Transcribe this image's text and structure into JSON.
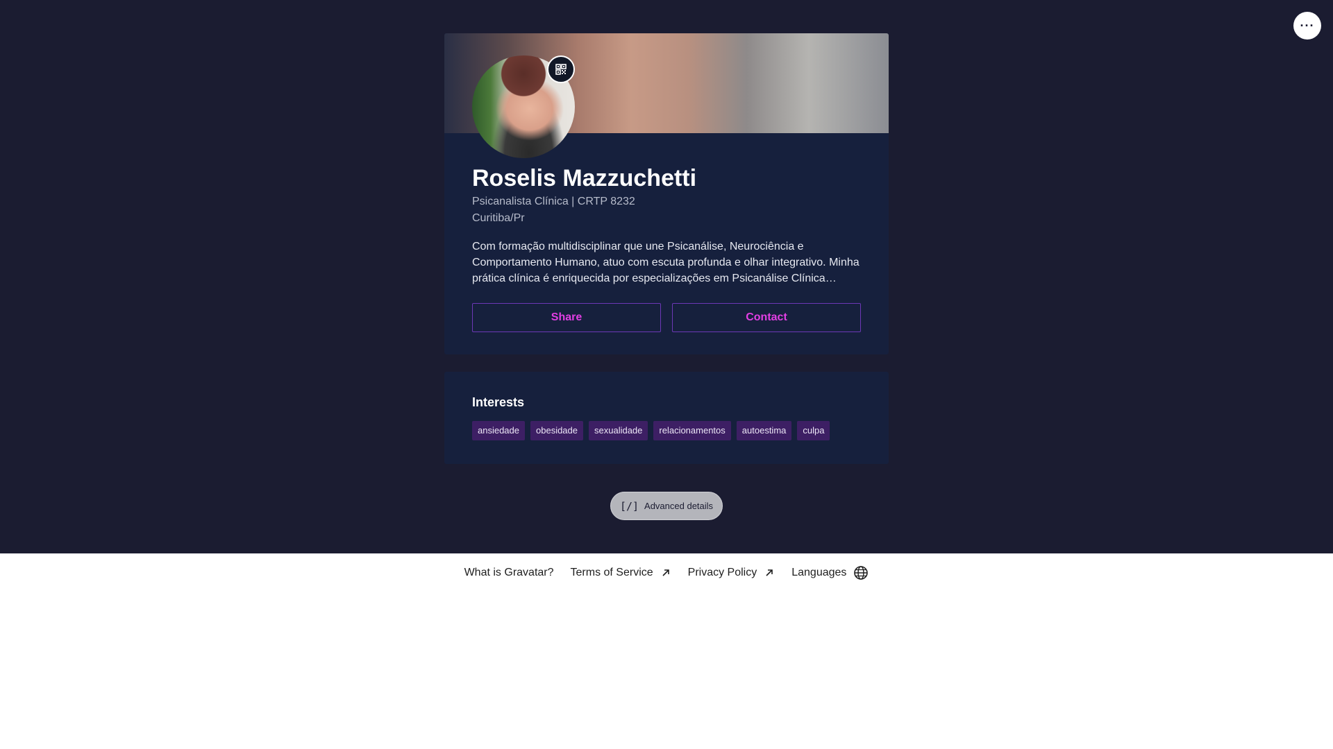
{
  "topbar": {
    "more_icon": "more-horizontal-icon",
    "more_label": "···"
  },
  "profile": {
    "name": "Roselis Mazzuchetti",
    "subtitle": "Psicanalista Clínica | CRTP 8232",
    "location": "Curitiba/Pr",
    "bio": "Com formação multidisciplinar que une Psicanálise, Neurociência e Comportamento Humano, atuo com escuta profunda e olhar integrativo. Minha prática clínica é enriquecida por especializações em Psicanálise Clínica Avançada…",
    "share_label": "Share",
    "contact_label": "Contact",
    "qr_icon": "qr-code-icon",
    "colors": {
      "accent": "#e23fe4",
      "button_border": "#6d38b7",
      "card_bg": "#16203d",
      "page_bg": "#1b1c31"
    }
  },
  "interests": {
    "title": "Interests",
    "tags": [
      "ansiedade",
      "obesidade",
      "sexualidade",
      "relacionamentos",
      "autoestima",
      "culpa"
    ],
    "tag_bg": "#3d1f64"
  },
  "advanced": {
    "icon": "[/]",
    "label": "Advanced details"
  },
  "footer": {
    "links": [
      {
        "label": "What is Gravatar?",
        "icon": ""
      },
      {
        "label": "Terms of Service",
        "icon": "external-link-icon"
      },
      {
        "label": "Privacy Policy",
        "icon": "external-link-icon"
      },
      {
        "label": "Languages",
        "icon": "globe-icon"
      }
    ]
  }
}
